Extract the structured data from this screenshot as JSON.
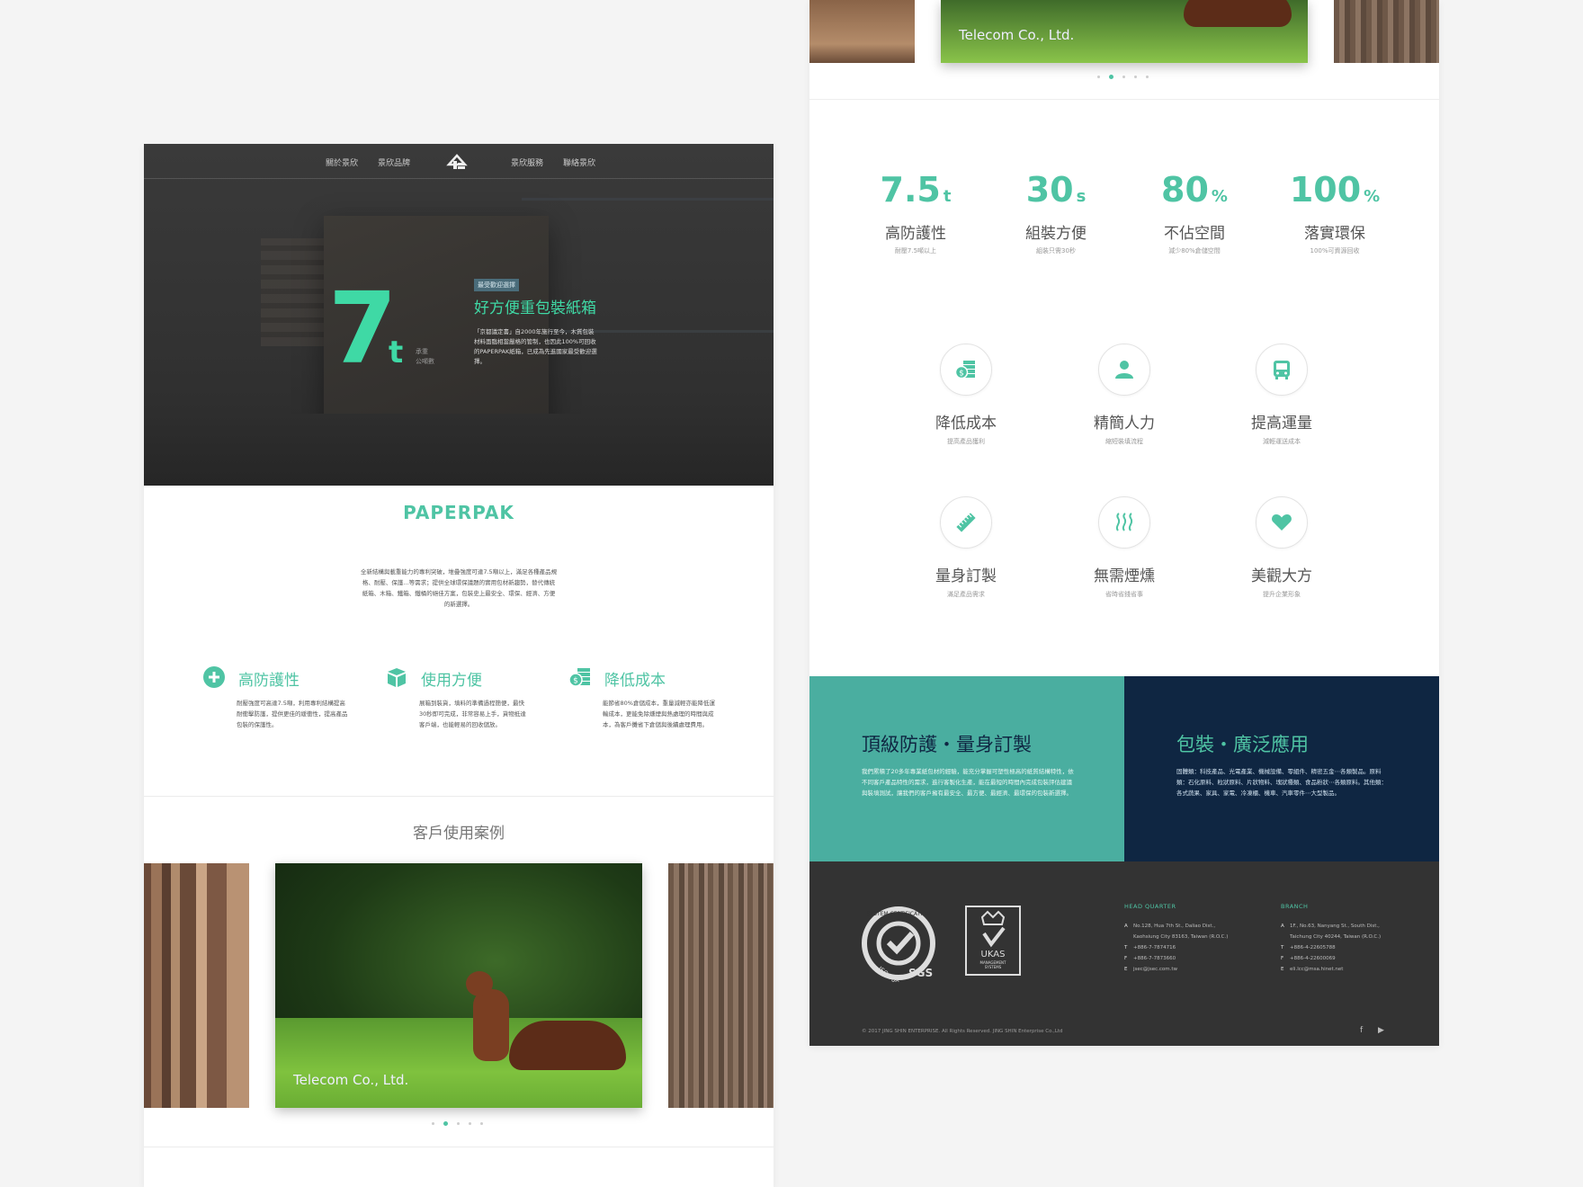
{
  "left": {
    "nav": [
      "關於景欣",
      "景欣品牌",
      "景欣服務",
      "聯絡景欣"
    ],
    "hero": {
      "big_number": "7",
      "unit": "t",
      "load_label": "承重\n公噸數",
      "badge": "最受歡迎選擇",
      "title": "好方便重包裝紙箱",
      "desc": "「京都議定書」自2000年施行至今，木質包裝材料面臨相當嚴格的管制，也因此100%可回收的PAPERPAK紙箱，已成為先進國家最受歡迎選擇。"
    },
    "brand": {
      "name": "PAPERPAK",
      "desc": "全新結構與載重能力的專利突破，堆疊強度可達7.5噸以上，滿足各種產品規格、耐壓、保護...等需求；提供全球環保議題的實用包材新趨勢，替代傳統紙箱、木箱、鐵箱、鐵桶的絕佳方案，包裝史上最安全、環保、經濟、方便的新選擇。"
    },
    "features": [
      {
        "title": "高防護性",
        "desc": "耐壓強度可高達7.5噸，利用專利結構提高耐衝擊防護，提供更佳的緩衝性，提高產品包裝的保護性。"
      },
      {
        "title": "使用方便",
        "desc": "展箱到裝貨，填料的準備過程簡便，最快30秒即可完成，非常容易上手，貨物抵達客戶端，也能輕易的回收儲放。"
      },
      {
        "title": "降低成本",
        "desc": "能節省80%倉儲成本，重量減輕亦能降低運輸成本，更能免除燻煙與熱處理的時間與成本，為客戶攤省下倉儲與後續處理費用。"
      }
    ],
    "cases_title": "客戶使用案例",
    "carousel_caption": "Telecom Co., Ltd."
  },
  "right": {
    "carousel_caption": "Telecom Co., Ltd.",
    "stats": [
      {
        "value": "7.5",
        "unit": "t",
        "label": "高防護性",
        "sub": "耐壓7.5噸以上"
      },
      {
        "value": "30",
        "unit": "s",
        "label": "組裝方便",
        "sub": "組裝只需30秒"
      },
      {
        "value": "80",
        "unit": "%",
        "label": "不佔空間",
        "sub": "減少80%倉儲空間"
      },
      {
        "value": "100",
        "unit": "%",
        "label": "落實環保",
        "sub": "100%可資源回收"
      }
    ],
    "benefits": [
      {
        "icon": "money-coins-icon",
        "label": "降低成本",
        "sub": "提高產品獲利"
      },
      {
        "icon": "person-icon",
        "label": "精簡人力",
        "sub": "縮短裝填流程"
      },
      {
        "icon": "bus-icon",
        "label": "提高運量",
        "sub": "減輕運送成本"
      },
      {
        "icon": "ruler-icon",
        "label": "量身訂製",
        "sub": "滿足產品需求"
      },
      {
        "icon": "steam-icon",
        "label": "無需煙燻",
        "sub": "省時省錢省事"
      },
      {
        "icon": "heart-icon",
        "label": "美觀大方",
        "sub": "提升企業形象"
      }
    ],
    "split": {
      "left_title": "頂級防護・量身訂製",
      "left_desc": "我們累積了20多年專業紙包材的經驗，能充分掌握可塑性極高的紙質結構特性，依不同客戶產品特性的需求，進行客製化生產，能在最短的時間內完成包裝評估建議與裝填測試，讓我們的客戶擁有最安全、最方便、最經濟、最環保的包裝新選擇。",
      "right_title": "包裝・廣泛應用",
      "right_desc": "固體類：科技產品、光電產業、機械設備、零組件、精密五金⋯各類製品。原料類：石化原料、粒狀原料、片狀物料、塊狀種類、食品粉狀⋯各類原料。其他類：各式蔬果、家具、家電、冷凍櫃、機車、汽車零件⋯大型製品。"
    },
    "footer": {
      "hq_title": "HEAD QUARTER",
      "hq_lines": [
        {
          "k": "A",
          "v": "No.128, Hua 7th St., Daliao Dist.,"
        },
        {
          "k": "",
          "v": "Kaohsiung City 83163, Taiwan (R.O.C.)"
        },
        {
          "k": "T",
          "v": "+886-7-7874716"
        },
        {
          "k": "F",
          "v": "+886-7-7873660"
        },
        {
          "k": "E",
          "v": "jsec@jsec.com.tw"
        }
      ],
      "branch_title": "BRANCH",
      "branch_lines": [
        {
          "k": "A",
          "v": "1F., No.63, Nanyang St., South Dist.,"
        },
        {
          "k": "",
          "v": "Taichung City 40244, Taiwan (R.O.C.)"
        },
        {
          "k": "T",
          "v": "+886-4-22605788"
        },
        {
          "k": "F",
          "v": "+886-4-22600069"
        },
        {
          "k": "E",
          "v": "eli.lcc@msa.hinet.net"
        }
      ],
      "copyright": "© 2017 JING SHIN ENTERPRISE. All Rights Reserved. JING SHIN Enterprise Co.,Ltd",
      "social_f": "f",
      "social_y": "▶"
    }
  },
  "colors": {
    "accent": "#4fc4a4",
    "teal_band": "#4aaea0",
    "navy_band": "#0f2642",
    "footer": "#333333"
  }
}
